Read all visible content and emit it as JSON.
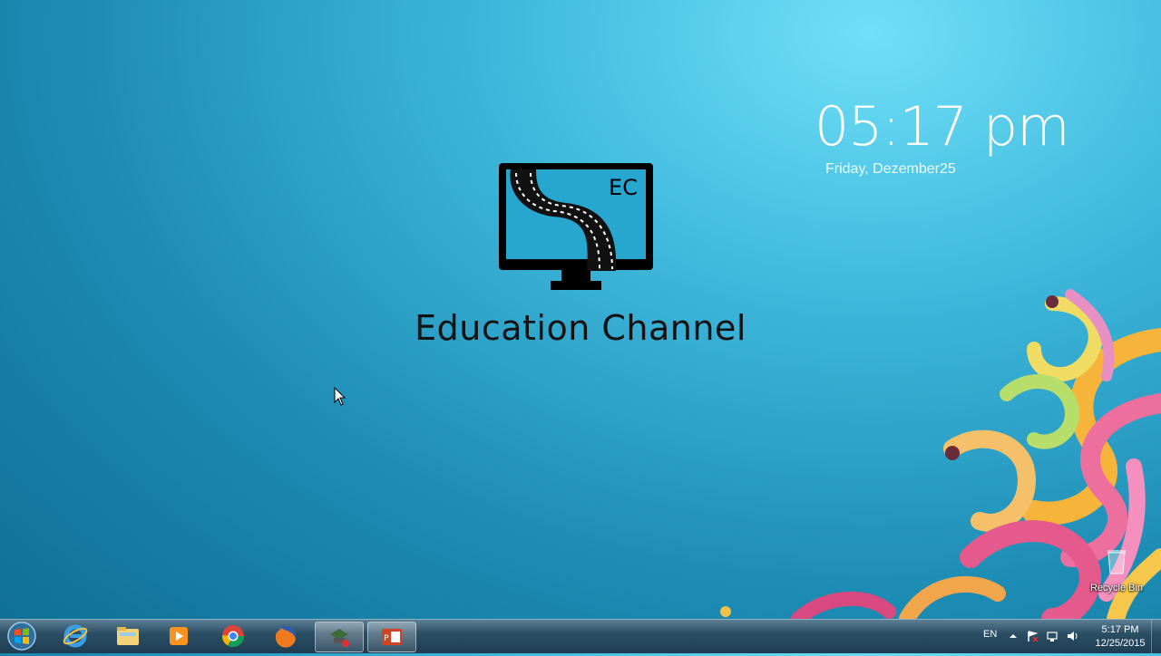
{
  "clock": {
    "time": "05:17 pm",
    "date": "Friday, Dezember25"
  },
  "logo": {
    "badge": "EC",
    "title": "Education Channel"
  },
  "desktop_icons": [
    {
      "label": "Recycle Bin",
      "icon": "recycle-bin-icon"
    }
  ],
  "taskbar": {
    "start": "windows-start-icon",
    "items": [
      {
        "name": "internet-explorer-icon"
      },
      {
        "name": "file-explorer-icon"
      },
      {
        "name": "media-player-icon"
      },
      {
        "name": "chrome-icon"
      },
      {
        "name": "firefox-icon"
      },
      {
        "name": "recording-app-icon"
      },
      {
        "name": "powerpoint-icon"
      }
    ],
    "tray": {
      "language": "EN",
      "time": "5:17 PM",
      "date": "12/25/2015"
    }
  },
  "colors": {
    "desktop": "#1c8bb3",
    "taskbar": "#2c4f66"
  }
}
